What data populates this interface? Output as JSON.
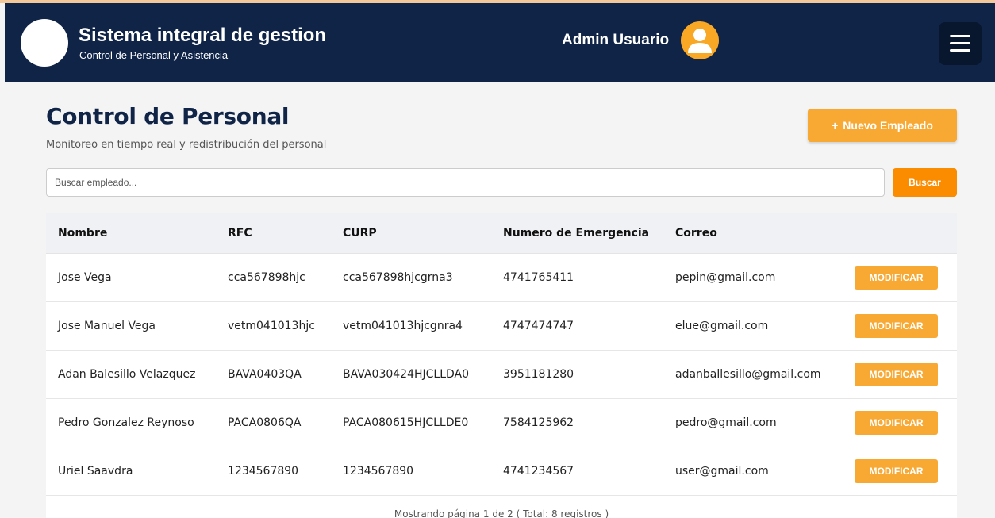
{
  "header": {
    "app_title": "Sistema integral de gestion",
    "app_subtitle": "Control de Personal y Asistencia",
    "user_name": "Admin Usuario",
    "icons": {
      "avatar": "user-avatar-icon",
      "menu": "hamburger-menu-icon"
    },
    "colors": {
      "background": "#0f2447",
      "avatar": "#f9a825"
    }
  },
  "main": {
    "title": "Control de Personal",
    "subtitle": "Monitoreo en tiempo real y redistribución del personal",
    "new_button_label": "Nuevo Empleado",
    "new_button_icon": "+",
    "search": {
      "placeholder": "Buscar empleado...",
      "value": "",
      "button_label": "Buscar"
    }
  },
  "table": {
    "headers": [
      "Nombre",
      "RFC",
      "CURP",
      "Numero de Emergencia",
      "Correo"
    ],
    "action_label": "MODIFICAR",
    "rows": [
      [
        "Jose Vega",
        "cca567898hjc",
        "cca567898hjcgrna3",
        "4741765411",
        "pepin@gmail.com"
      ],
      [
        "Jose Manuel Vega",
        "vetm041013hjc",
        "vetm041013hjcgnra4",
        "4747474747",
        "elue@gmail.com"
      ],
      [
        "Adan Balesillo Velazquez",
        "BAVA0403QA",
        "BAVA030424HJCLLDA0",
        "3951181280",
        "adanballesillo@gmail.com"
      ],
      [
        "Pedro Gonzalez Reynoso",
        "PACA0806QA",
        "PACA080615HJCLLDE0",
        "7584125962",
        "pedro@gmail.com"
      ],
      [
        "Uriel Saavdra",
        "1234567890",
        "1234567890",
        "4741234567",
        "user@gmail.com"
      ]
    ],
    "pagination_text": "Mostrando página 1 de 2 ( Total: 8 registros )"
  },
  "colors": {
    "accent": "#f7a934",
    "search_button": "#fb8c00"
  }
}
